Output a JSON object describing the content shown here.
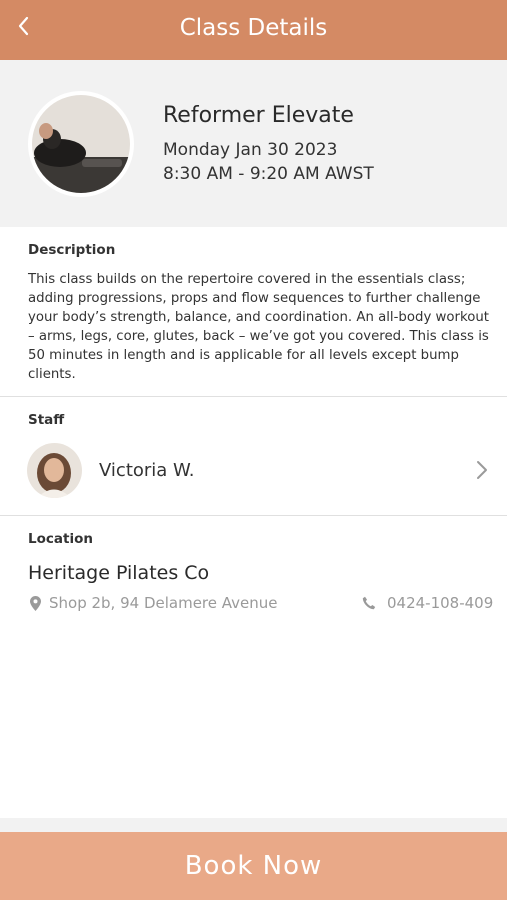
{
  "header": {
    "title": "Class Details",
    "back_icon": "chevron-left-icon",
    "background": "#d48a64"
  },
  "class_info": {
    "name": "Reformer Elevate",
    "date": "Monday Jan 30 2023",
    "time": "8:30 AM - 9:20 AM AWST"
  },
  "description": {
    "label": "Description",
    "text": "This class builds on the repertoire covered in the essentials class; adding progressions, props and flow sequences to further challenge your body’s strength, balance, and coordination. An all-body workout – arms, legs, core, glutes, back – we’ve got you covered. This class is 50 minutes in length and is applicable for all levels except bump clients."
  },
  "staff": {
    "label": "Staff",
    "name": "Victoria W.",
    "chevron_icon": "chevron-right-icon"
  },
  "location": {
    "label": "Location",
    "name": "Heritage Pilates Co",
    "address": "Shop 2b, 94 Delamere Avenue",
    "address_icon": "map-pin-icon",
    "phone": "0424-108-409",
    "phone_icon": "phone-icon"
  },
  "footer": {
    "book_label": "Book Now",
    "background": "#e9a988"
  }
}
